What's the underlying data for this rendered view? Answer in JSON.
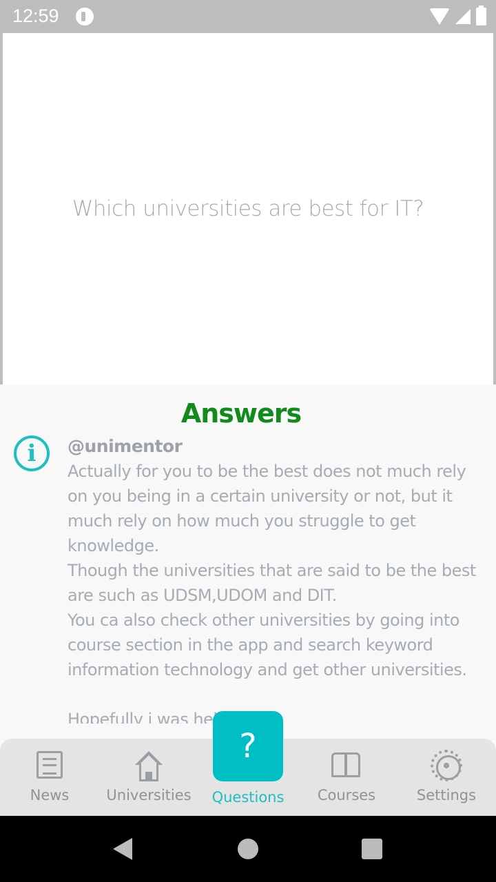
{
  "status_bar": {
    "time": "12:59"
  },
  "question": {
    "text": "Which universities are best for IT?"
  },
  "answers": {
    "title": "Answers",
    "items": [
      {
        "author": "@unimentor",
        "text": "Actually for you to be the best does not much rely on you being in a certain university or not, but it much rely on how much you struggle to get knowledge.\nThough the universities that are said to be the best are such as UDSM,UDOM and DIT.\nYou ca also check other universities by going into course section in the app and search keyword information technology and get other universities.\n\nHopefully i was helpful!",
        "icon": "info-icon"
      }
    ]
  },
  "bottom_nav": {
    "items": [
      {
        "label": "News",
        "icon": "news-icon"
      },
      {
        "label": "Universities",
        "icon": "home-icon"
      },
      {
        "label": "Questions",
        "icon": "question-icon",
        "active": true
      },
      {
        "label": "Courses",
        "icon": "book-icon"
      },
      {
        "label": "Settings",
        "icon": "gear-icon"
      }
    ],
    "accent_color": "#00bfc4"
  },
  "colors": {
    "answers_title": "#138a1e",
    "accent": "#1fbec3"
  }
}
